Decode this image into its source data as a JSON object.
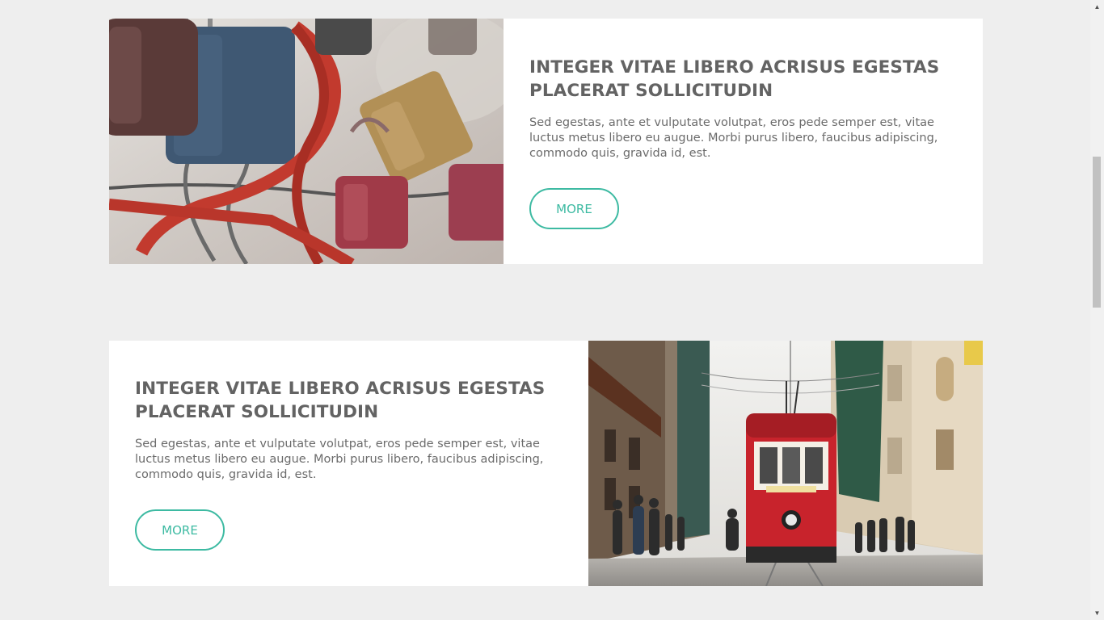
{
  "features": [
    {
      "title": "INTEGER VITAE LIBERO ACRISUS EGESTAS PLACERAT SOLLICITUDIN",
      "description": "Sed egestas, ante et vulputate volutpat, eros pede semper est, vitae luctus metus libero eu augue. Morbi purus libero, faucibus adipiscing, commodo quis, gravida id, est.",
      "button_label": "MORE",
      "image": "padlocks-photo"
    },
    {
      "title": "INTEGER VITAE LIBERO ACRISUS EGESTAS PLACERAT SOLLICITUDIN",
      "description": "Sed egestas, ante et vulputate volutpat, eros pede semper est, vitae luctus metus libero eu augue. Morbi purus libero, faucibus adipiscing, commodo quis, gravida id, est.",
      "button_label": "MORE",
      "image": "tram-street-photo"
    }
  ],
  "colors": {
    "background": "#eeeeee",
    "card": "#ffffff",
    "accent": "#3dbaa2",
    "heading": "#636363",
    "body_text": "#6b6b6b"
  },
  "scrollbar": {
    "up_icon": "triangle-up",
    "down_icon": "triangle-down"
  }
}
